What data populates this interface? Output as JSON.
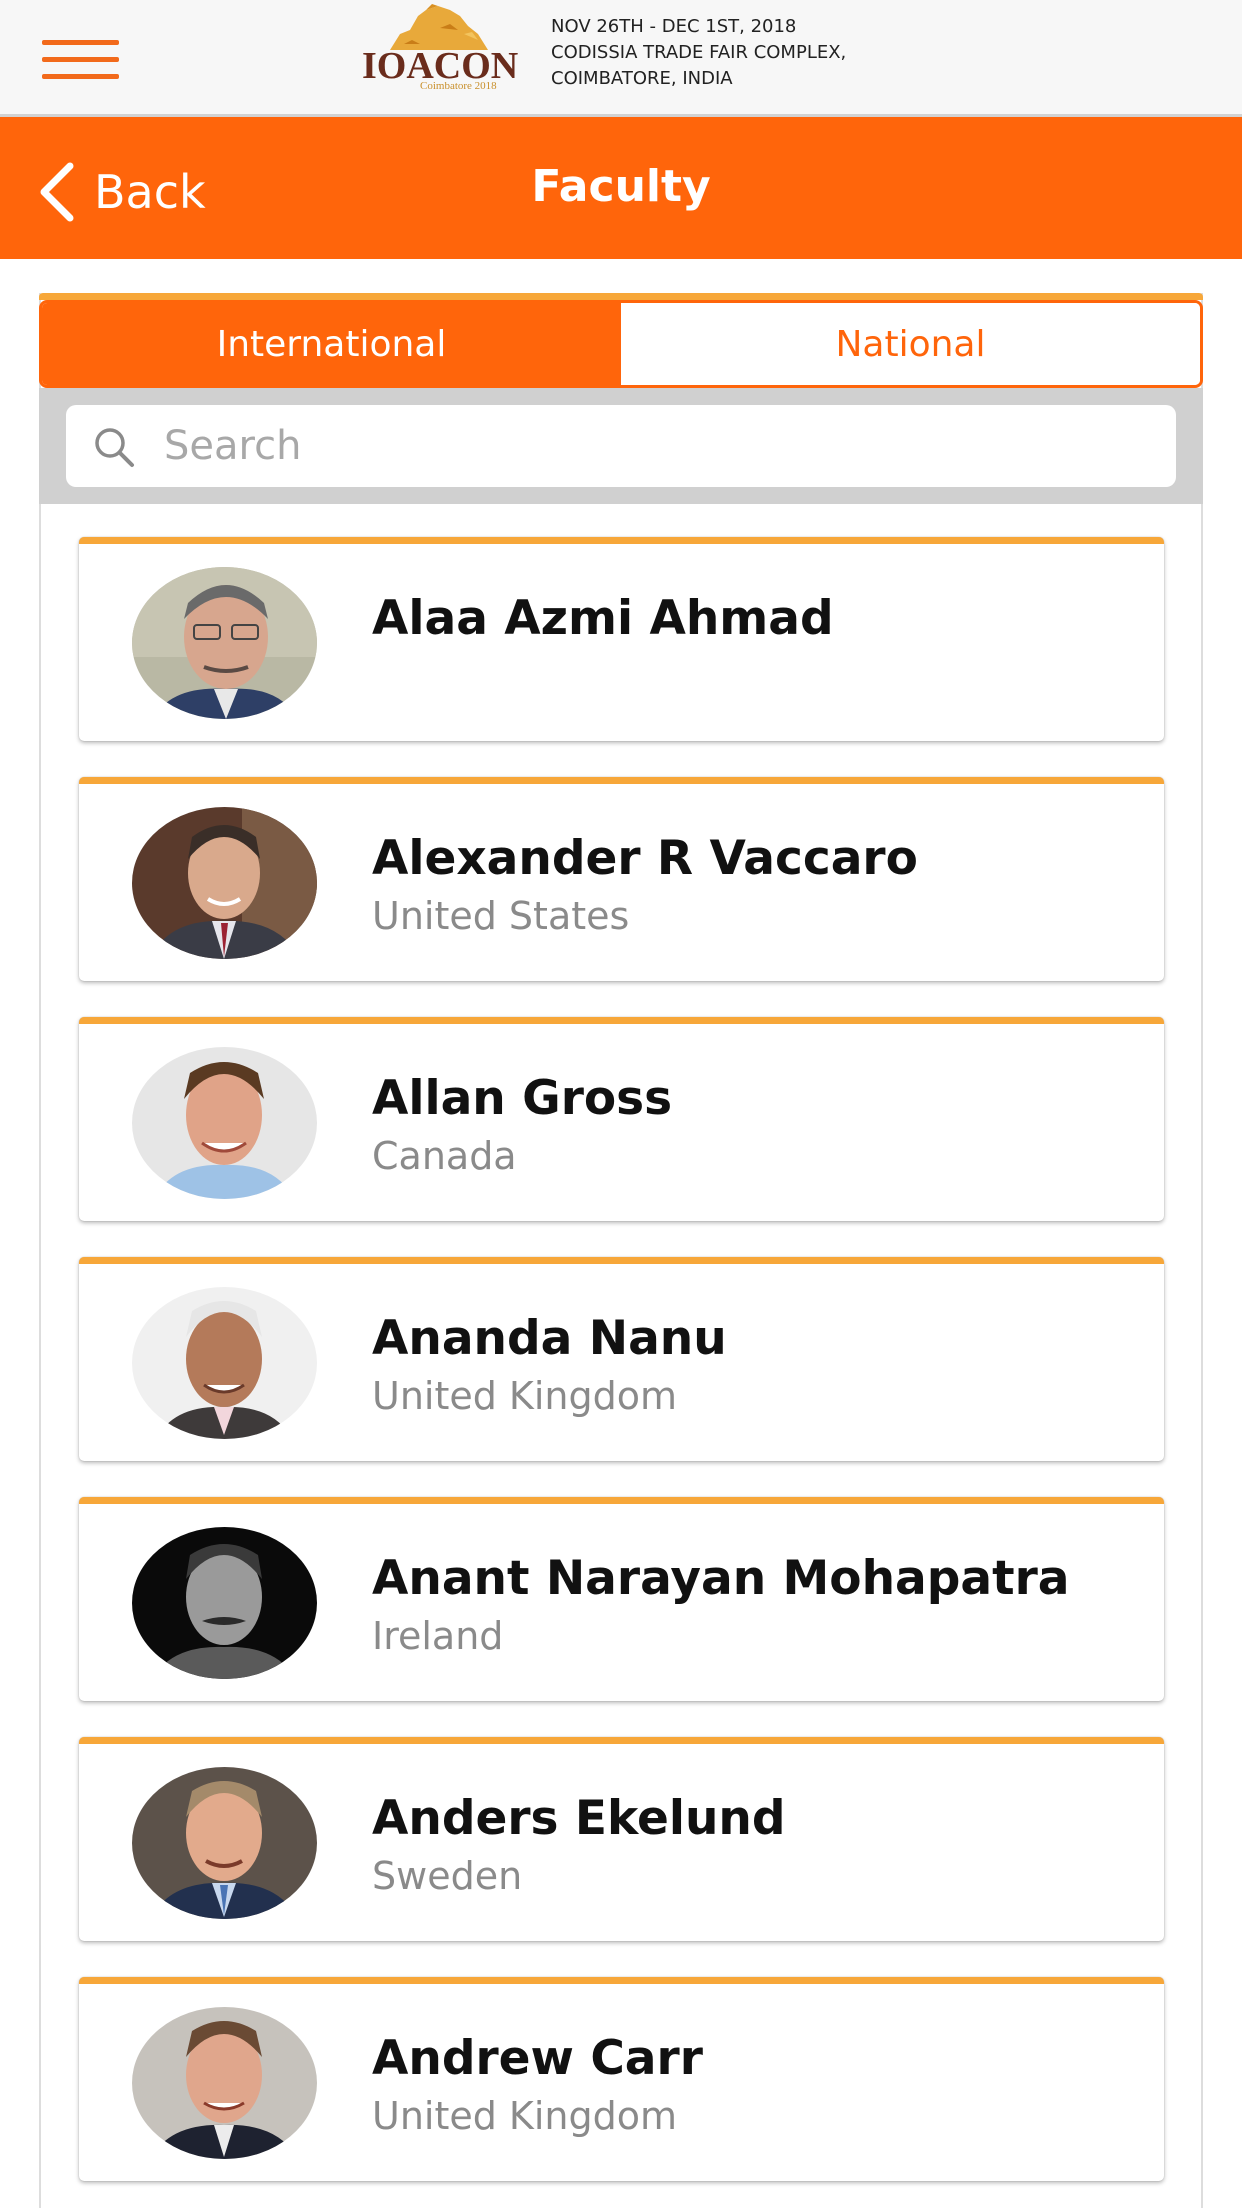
{
  "header": {
    "logo_text": "IOACON",
    "logo_subtext": "Coimbatore 2018",
    "event_lines": [
      "NOV 26TH - DEC 1ST, 2018",
      "CODISSIA TRADE FAIR COMPLEX,",
      "COIMBATORE, INDIA"
    ]
  },
  "title_bar": {
    "back_label": "Back",
    "title": "Faculty"
  },
  "tabs": [
    {
      "label": "International",
      "active": true
    },
    {
      "label": "National",
      "active": false
    }
  ],
  "search": {
    "placeholder": "Search",
    "value": ""
  },
  "faculty": [
    {
      "name": "Alaa Azmi Ahmad",
      "country": "",
      "avatar_icon": "person-photo"
    },
    {
      "name": "Alexander R Vaccaro",
      "country": "United States",
      "avatar_icon": "person-photo"
    },
    {
      "name": "Allan Gross",
      "country": "Canada",
      "avatar_icon": "person-photo"
    },
    {
      "name": "Ananda Nanu",
      "country": "United Kingdom",
      "avatar_icon": "person-photo"
    },
    {
      "name": "Anant Narayan Mohapatra",
      "country": "Ireland",
      "avatar_icon": "person-photo"
    },
    {
      "name": "Anders Ekelund",
      "country": "Sweden",
      "avatar_icon": "person-photo"
    },
    {
      "name": "Andrew Carr",
      "country": "United Kingdom",
      "avatar_icon": "person-photo"
    }
  ],
  "colors": {
    "accent_orange": "#ff650b",
    "card_top_border": "#f7a739",
    "menu_icon": "#f26a1b"
  }
}
